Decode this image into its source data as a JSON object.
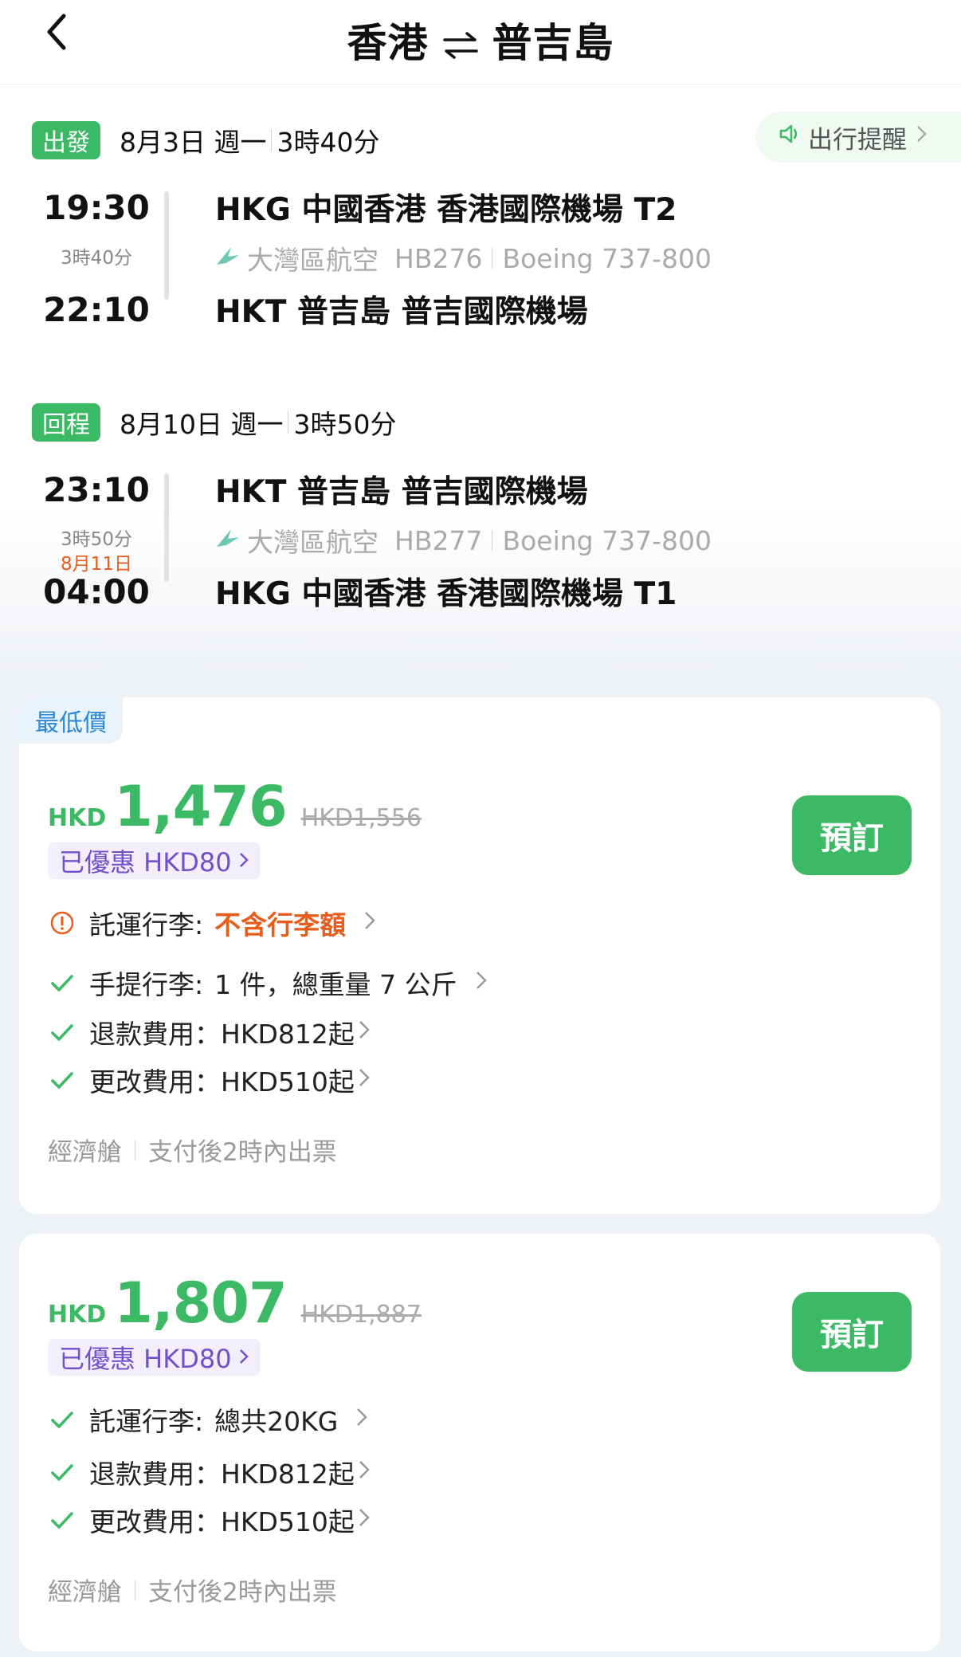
{
  "header": {
    "origin": "香港",
    "destination": "普吉島"
  },
  "reminder": {
    "label": "出行提醒"
  },
  "outbound": {
    "tag": "出發",
    "date": "8月3日 週一",
    "duration": "3時40分",
    "depart_time": "19:30",
    "flight_duration": "3時40分",
    "arrive_time": "22:10",
    "depart_airport": "HKG 中國香港 香港國際機場 T2",
    "airline": "大灣區航空",
    "flight_no": "HB276",
    "aircraft": "Boeing 737-800",
    "arrive_airport": "HKT 普吉島 普吉國際機場"
  },
  "return": {
    "tag": "回程",
    "date": "8月10日 週一",
    "duration": "3時50分",
    "depart_time": "23:10",
    "flight_duration": "3時50分",
    "next_day": "8月11日",
    "arrive_time": "04:00",
    "depart_airport": "HKT 普吉島 普吉國際機場",
    "airline": "大灣區航空",
    "flight_no": "HB277",
    "aircraft": "Boeing 737-800",
    "arrive_airport": "HKG 中國香港 香港國際機場 T1"
  },
  "fares": [
    {
      "badge": "最低價",
      "currency": "HKD",
      "price": "1,476",
      "original": "HKD1,556",
      "discount": "已優惠 HKD80",
      "book": "預訂",
      "checked_label": "託運行李:",
      "checked_value": "不含行李額",
      "carry_label": "手提行李:",
      "carry_value": "1 件，總重量 7 公斤",
      "refund": "退款費用：HKD812起",
      "change": "更改費用：HKD510起",
      "cabin": "經濟艙",
      "ticketing": "支付後2時內出票"
    },
    {
      "currency": "HKD",
      "price": "1,807",
      "original": "HKD1,887",
      "discount": "已優惠 HKD80",
      "book": "預訂",
      "checked_label": "託運行李:",
      "checked_value": "總共20KG",
      "refund": "退款費用：HKD812起",
      "change": "更改費用：HKD510起",
      "cabin": "經濟艙",
      "ticketing": "支付後2時內出票"
    }
  ],
  "colors": {
    "accent_green": "#3cb964",
    "warning_orange": "#e85d1b",
    "discount_purple": "#6e52cc",
    "badge_blue": "#2d87d8"
  }
}
